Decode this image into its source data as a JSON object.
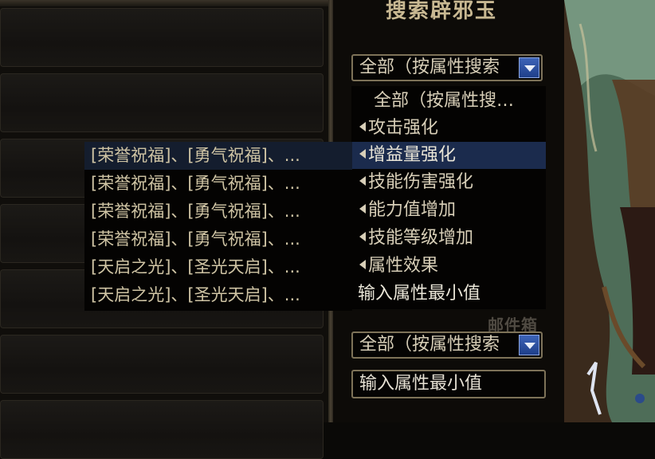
{
  "search_panel": {
    "title": "搜索辟邪玉",
    "select_1": {
      "value": "全部（按属性搜索"
    },
    "select_2": {
      "value": "全部（按属性搜索"
    },
    "min_value_input": {
      "placeholder": "输入属性最小值"
    },
    "mailbox_label": "邮件箱"
  },
  "dropdown": {
    "items": [
      {
        "label": "全部（按属性搜…",
        "arrow": false,
        "selected": false
      },
      {
        "label": "攻击强化",
        "arrow": true,
        "selected": false
      },
      {
        "label": "增益量强化",
        "arrow": true,
        "selected": true
      },
      {
        "label": "技能伤害强化",
        "arrow": true,
        "selected": false
      },
      {
        "label": "能力值增加",
        "arrow": true,
        "selected": false
      },
      {
        "label": "技能等级增加",
        "arrow": true,
        "selected": false
      },
      {
        "label": "属性效果",
        "arrow": true,
        "selected": false
      },
      {
        "label": "输入属性最小值",
        "arrow": false,
        "selected": false
      }
    ]
  },
  "results": {
    "items": [
      {
        "label": "[荣誉祝福]、[勇气祝福]、..."
      },
      {
        "label": "[荣誉祝福]、[勇气祝福]、..."
      },
      {
        "label": "[荣誉祝福]、[勇气祝福]、..."
      },
      {
        "label": "[荣誉祝福]、[勇气祝福]、..."
      },
      {
        "label": "[天启之光]、[圣光天启]、..."
      },
      {
        "label": "[天启之光]、[圣光天启]、..."
      }
    ]
  },
  "colors": {
    "selection_bg": "#1b2b4d",
    "text_gold": "#cfc4a4",
    "accent_blue": "#3d64b8"
  }
}
